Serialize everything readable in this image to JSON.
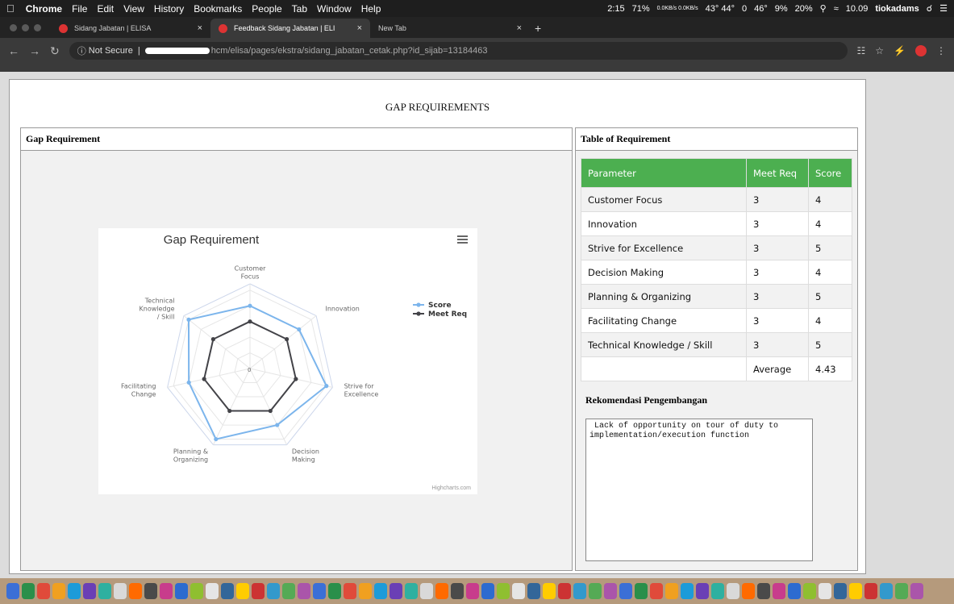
{
  "menubar": {
    "app": "Chrome",
    "items": [
      "File",
      "Edit",
      "View",
      "History",
      "Bookmarks",
      "People",
      "Tab",
      "Window",
      "Help"
    ],
    "status": [
      "2:15",
      "71%",
      "0.0KB/s 0.0KB/s",
      "43° 44°",
      "0",
      "46°",
      "9%",
      "20%",
      "10.09"
    ],
    "user": "tiokadams"
  },
  "tabs": [
    {
      "title": "Sidang Jabatan | ELISA",
      "active": false
    },
    {
      "title": "Feedback Sidang Jabatan | ELI",
      "active": true
    },
    {
      "title": "New Tab",
      "active": false
    }
  ],
  "address": {
    "security": "Not Secure",
    "url": "hcm/elisa/pages/ekstra/sidang_jabatan_cetak.php?id_sijab=13184463"
  },
  "page": {
    "title": "GAP REQUIREMENTS",
    "left_header": "Gap Requirement",
    "right_header": "Table of Requirement"
  },
  "chart_data": {
    "type": "radar",
    "title": "Gap Requirement",
    "categories": [
      "Customer Focus",
      "Innovation",
      "Strive for Excellence",
      "Decision Making",
      "Planning & Organizing",
      "Facilitating Change",
      "Technical Knowledge / Skill"
    ],
    "category_lines": [
      [
        "Customer",
        "Focus"
      ],
      [
        "Innovation"
      ],
      [
        "Strive for",
        "Excellence"
      ],
      [
        "Decision",
        "Making"
      ],
      [
        "Planning &",
        "Organizing"
      ],
      [
        "Facilitating",
        "Change"
      ],
      [
        "Technical",
        "Knowledge",
        "/ Skill"
      ]
    ],
    "series": [
      {
        "name": "Score",
        "values": [
          4,
          4,
          5,
          4,
          5,
          4,
          5
        ],
        "color": "#7cb5ec"
      },
      {
        "name": "Meet Req",
        "values": [
          3,
          3,
          3,
          3,
          3,
          3,
          3
        ],
        "color": "#434348"
      }
    ],
    "axis_min_label": "0",
    "credit": "Highcharts.com",
    "legend_position": "top-right"
  },
  "table": {
    "headers": [
      "Parameter",
      "Meet Req",
      "Score"
    ],
    "rows": [
      [
        "Customer Focus",
        "3",
        "4"
      ],
      [
        "Innovation",
        "3",
        "4"
      ],
      [
        "Strive for Excellence",
        "3",
        "5"
      ],
      [
        "Decision Making",
        "3",
        "4"
      ],
      [
        "Planning & Organizing",
        "3",
        "5"
      ],
      [
        "Facilitating Change",
        "3",
        "4"
      ],
      [
        "Technical Knowledge / Skill",
        "3",
        "5"
      ],
      [
        "",
        "Average",
        "4.43"
      ]
    ],
    "header_color": "#4caf50"
  },
  "recommendation": {
    "title": "Rekomendasi Pengembangan",
    "text": " Lack of opportunity on tour of duty to\nimplementation/execution function"
  }
}
